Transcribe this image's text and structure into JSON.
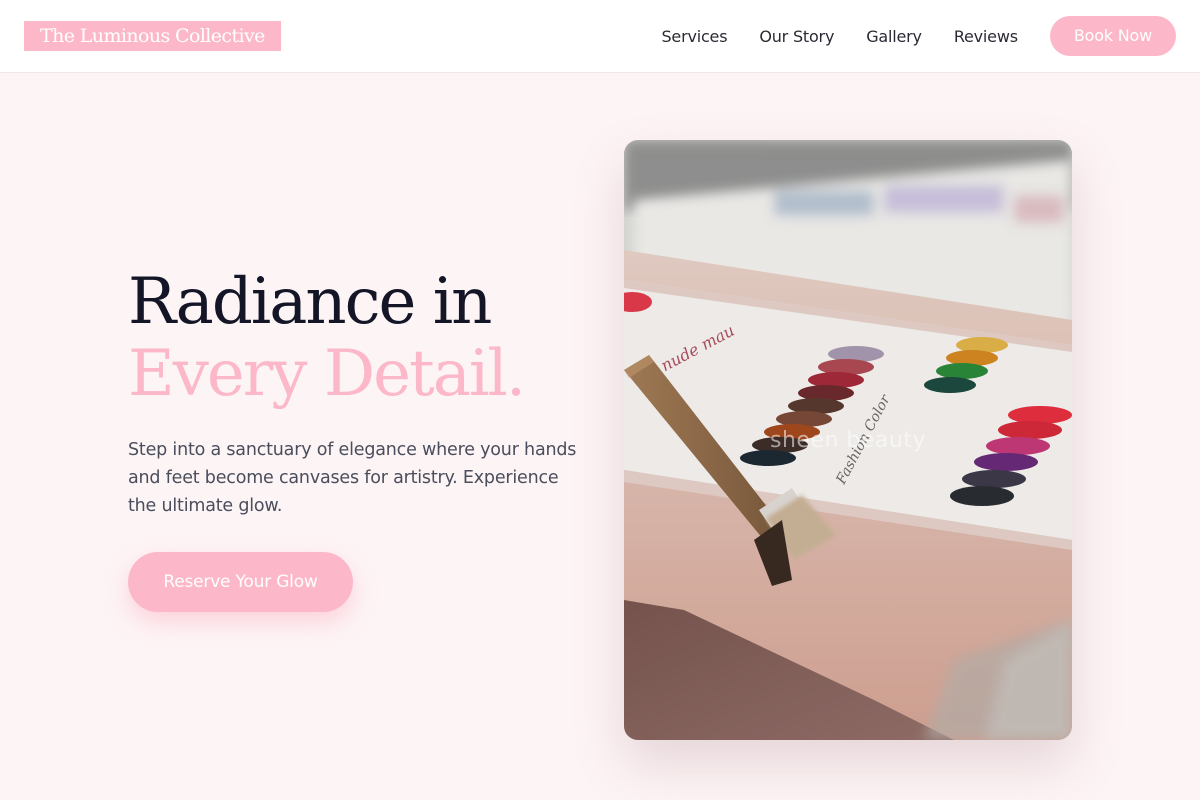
{
  "header": {
    "logo": "The Luminous Collective",
    "nav": [
      "Services",
      "Our Story",
      "Gallery",
      "Reviews"
    ],
    "book_button": "Book Now"
  },
  "hero": {
    "title_line1": "Radiance in",
    "title_line2": "Every Detail.",
    "description": "Step into a sanctuary of elegance where your hands and feet become canvases for artistry. Experience the ultimate glow.",
    "cta": "Reserve Your Glow",
    "image": {
      "alt": "Nail polish color swatch chart with a brush",
      "watermark": "sheen beauty"
    }
  },
  "colors": {
    "accent": "#fcb8c8",
    "heading": "#141627",
    "page_bg": "#fdf4f5"
  }
}
